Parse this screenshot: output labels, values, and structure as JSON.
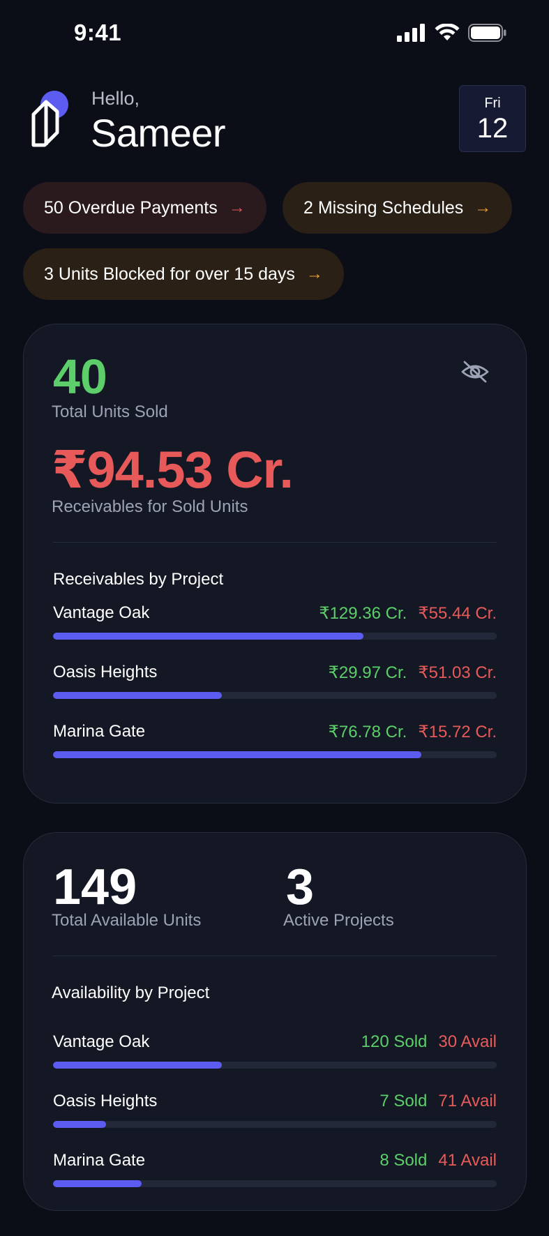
{
  "status_bar": {
    "time": "9:41"
  },
  "header": {
    "greeting": "Hello,",
    "name": "Sameer",
    "date_day": "Fri",
    "date_num": "12"
  },
  "alerts": [
    {
      "label": "50 Overdue Payments",
      "arrow": "→",
      "color": "#e05a55"
    },
    {
      "label": "2 Missing Schedules",
      "arrow": "→",
      "color": "#f2a03a"
    },
    {
      "label": "3 Units Blocked for over 15 days",
      "arrow": "→",
      "color": "#f2a03a"
    }
  ],
  "sales_card": {
    "units_sold": "40",
    "units_sold_label": "Total Units Sold",
    "receivables": "₹94.53 Cr.",
    "receivables_label": "Receivables for Sold Units",
    "section_title": "Receivables by Project",
    "projects": [
      {
        "name": "Vantage Oak",
        "received": "₹129.36 Cr.",
        "pending": "₹55.44 Cr.",
        "progress": 0.7
      },
      {
        "name": "Oasis Heights",
        "received": "₹29.97 Cr.",
        "pending": "₹51.03 Cr.",
        "progress": 0.38
      },
      {
        "name": "Marina Gate",
        "received": "₹76.78 Cr.",
        "pending": "₹15.72 Cr.",
        "progress": 0.83
      }
    ]
  },
  "availability_card": {
    "available_units": "149",
    "available_units_label": "Total Available Units",
    "active_projects": "3",
    "active_projects_label": "Active Projects",
    "section_title": "Availability by Project",
    "projects": [
      {
        "name": "Vantage Oak",
        "sold": "120 Sold",
        "avail": "30 Avail",
        "progress": 0.38
      },
      {
        "name": "Oasis Heights",
        "sold": "7 Sold",
        "avail": "71 Avail",
        "progress": 0.12
      },
      {
        "name": "Marina Gate",
        "sold": "8 Sold",
        "avail": "41 Avail",
        "progress": 0.2
      }
    ]
  },
  "colors": {
    "background": "#0b0e17",
    "card": "#141824",
    "accent": "#5c5cf0",
    "positive": "#5ccf6a",
    "negative": "#e85a5a",
    "warning": "#f2a03a"
  },
  "icons": {
    "logo": "brand-logo-icon",
    "visibility": "eye-off-icon",
    "signal": "cellular-signal-icon",
    "wifi": "wifi-icon",
    "battery": "battery-icon"
  }
}
